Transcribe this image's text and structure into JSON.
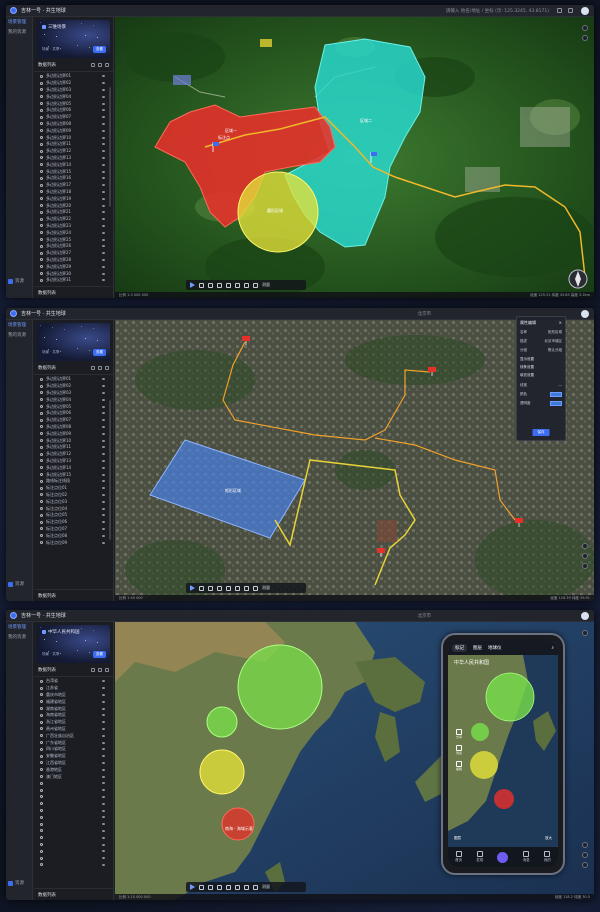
{
  "app": {
    "title": "吉林一号 · 共生地球"
  },
  "rail": {
    "items": [
      "场景管理",
      "我的资源"
    ],
    "bottom": "资源"
  },
  "card": {
    "title": "三维场景",
    "subtitle": "场景 · 共享",
    "button": "查看"
  },
  "panel": {
    "header": "数据列表",
    "footer": "数据列表"
  },
  "screen1": {
    "search": "请输入 地名/地址 / 坐标 (示: 125.3245, 43.8171)",
    "list": [
      "多边形边界01",
      "多边形边界02",
      "多边形边界03",
      "多边形边界04",
      "多边形边界05",
      "多边形边界06",
      "多边形边界07",
      "多边形边界08",
      "多边形边界09",
      "多边形边界10",
      "多边形边界11",
      "多边形边界12",
      "多边形边界13",
      "多边形边界14",
      "多边形边界15",
      "多边形边界16",
      "多边形边界17",
      "多边形边界18",
      "多边形边界19",
      "多边形边界20",
      "多边形边界21",
      "多边形边界22",
      "多边形边界23",
      "多边形边界24",
      "多边形边界25",
      "多边形边界26",
      "多边形边界27",
      "多边形边界28",
      "多边形边界29",
      "多边形边界30",
      "多边形边界31"
    ],
    "labels": {
      "red": "区域一",
      "cyan": "区域二",
      "yellow": "圆形区域",
      "flag": "标注点"
    },
    "status_left": "比例 1:3 000 000",
    "status_right": "经度 125.31 纬度 43.85 高度 3.2km"
  },
  "screen2": {
    "search": "北京市",
    "list": [
      "多边形边界01",
      "多边形边界02",
      "多边形边界03",
      "多边形边界04",
      "多边形边界05",
      "多边形边界06",
      "多边形边界07",
      "多边形边界08",
      "多边形边界09",
      "多边形边界10",
      "多边形边界11",
      "多边形边界12",
      "多边形边界13",
      "多边形边界14",
      "多边形边界15",
      "路线标注线段",
      "标注点位01",
      "标注点位02",
      "标注点位03",
      "标注点位04",
      "标注点位05",
      "标注点位06",
      "标注点位07",
      "标注点位08",
      "标注点位09"
    ],
    "rect_label": "矩形区域",
    "attr": {
      "title": "属性编辑",
      "rows": [
        {
          "k": "名称",
          "v": "矩形区域"
        },
        {
          "k": "描述",
          "v": "北京市城区"
        },
        {
          "k": "分组",
          "v": "默认分组"
        }
      ],
      "sections": [
        "显示设置",
        "线条设置",
        "填充设置"
      ],
      "fields": [
        "线宽",
        "颜色",
        "透明度"
      ],
      "button": "保存"
    },
    "status_left": "比例 1:50 000",
    "status_right": "经度 116.39 纬度 39.91"
  },
  "screen3": {
    "search": "北京市",
    "card_title": "中华人民共和国",
    "list": [
      "台湾省",
      "江苏省",
      "重庆市地区",
      "福建省地区",
      "湖南省地区",
      "海南省地区",
      "浙江省地区",
      "贵州省地区",
      "广西壮族自治区",
      "广东省地区",
      "四川省地区",
      "安徽省地区",
      "江西省地区",
      "香港地区",
      "澳门地区",
      "",
      "",
      "",
      "",
      "",
      "",
      "",
      "",
      "",
      "",
      "",
      "",
      ""
    ],
    "south_label": "南海 · 海域示意",
    "status_left": "比例 1:10 000 000",
    "status_right": "经度 118.2 纬度 30.5"
  },
  "toolbar": {
    "label": "测量"
  },
  "phone": {
    "tabs": [
      "标记",
      "图层",
      "地球仪"
    ],
    "region": "中华人民共和国",
    "tools": [
      "分享",
      "列表",
      "编辑"
    ],
    "bottom_left": "图层",
    "bottom_right": "放大",
    "nav": [
      "首页",
      "发现",
      "",
      "消息",
      "我的"
    ]
  },
  "colors": {
    "accent": "#3d6df2",
    "red": "#e8302a",
    "cyan": "#28dcd2",
    "yellow": "#e4e23a",
    "green": "#78e04a",
    "blue": "#4a7fe0"
  }
}
